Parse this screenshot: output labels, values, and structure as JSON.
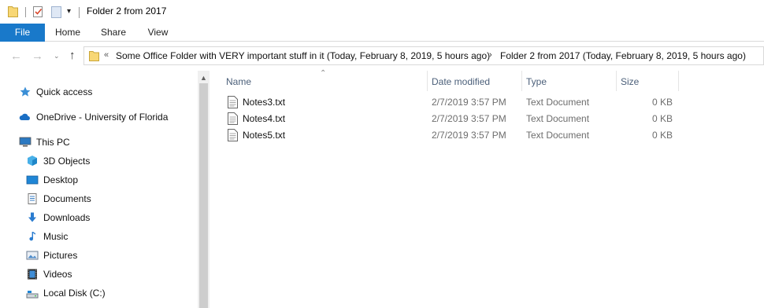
{
  "window": {
    "title": "Folder 2 from 2017",
    "quick_access_dropdown": "▾"
  },
  "ribbon": {
    "tabs": [
      {
        "label": "File",
        "active": true
      },
      {
        "label": "Home"
      },
      {
        "label": "Share"
      },
      {
        "label": "View"
      }
    ]
  },
  "address": {
    "overflow": "«",
    "segments": [
      "Some Office Folder with VERY important stuff in it (Today, February 8, 2019, 5 hours ago)",
      "Folder 2 from 2017 (Today, February 8, 2019, 5 hours ago)"
    ],
    "separator": "›"
  },
  "nav": {
    "items": [
      {
        "label": "Quick access",
        "icon": "star-icon"
      },
      {
        "label": "OneDrive - University of Florida",
        "icon": "cloud-icon"
      },
      {
        "label": "This PC",
        "icon": "monitor-icon"
      },
      {
        "label": "3D Objects",
        "icon": "cube-icon"
      },
      {
        "label": "Desktop",
        "icon": "desktop-icon"
      },
      {
        "label": "Documents",
        "icon": "documents-icon"
      },
      {
        "label": "Downloads",
        "icon": "download-arrow-icon"
      },
      {
        "label": "Music",
        "icon": "music-note-icon"
      },
      {
        "label": "Pictures",
        "icon": "pictures-icon"
      },
      {
        "label": "Videos",
        "icon": "film-icon"
      },
      {
        "label": "Local Disk (C:)",
        "icon": "drive-icon"
      }
    ]
  },
  "filelist": {
    "columns": [
      "Name",
      "Date modified",
      "Type",
      "Size"
    ],
    "files": [
      {
        "name": "Notes3.txt",
        "date": "2/7/2019 3:57 PM",
        "type": "Text Document",
        "size": "0 KB"
      },
      {
        "name": "Notes4.txt",
        "date": "2/7/2019 3:57 PM",
        "type": "Text Document",
        "size": "0 KB"
      },
      {
        "name": "Notes5.txt",
        "date": "2/7/2019 3:57 PM",
        "type": "Text Document",
        "size": "0 KB"
      }
    ]
  },
  "colors": {
    "accent": "#1979ca",
    "folder": "#f8d775",
    "header_text": "#4c607a"
  }
}
